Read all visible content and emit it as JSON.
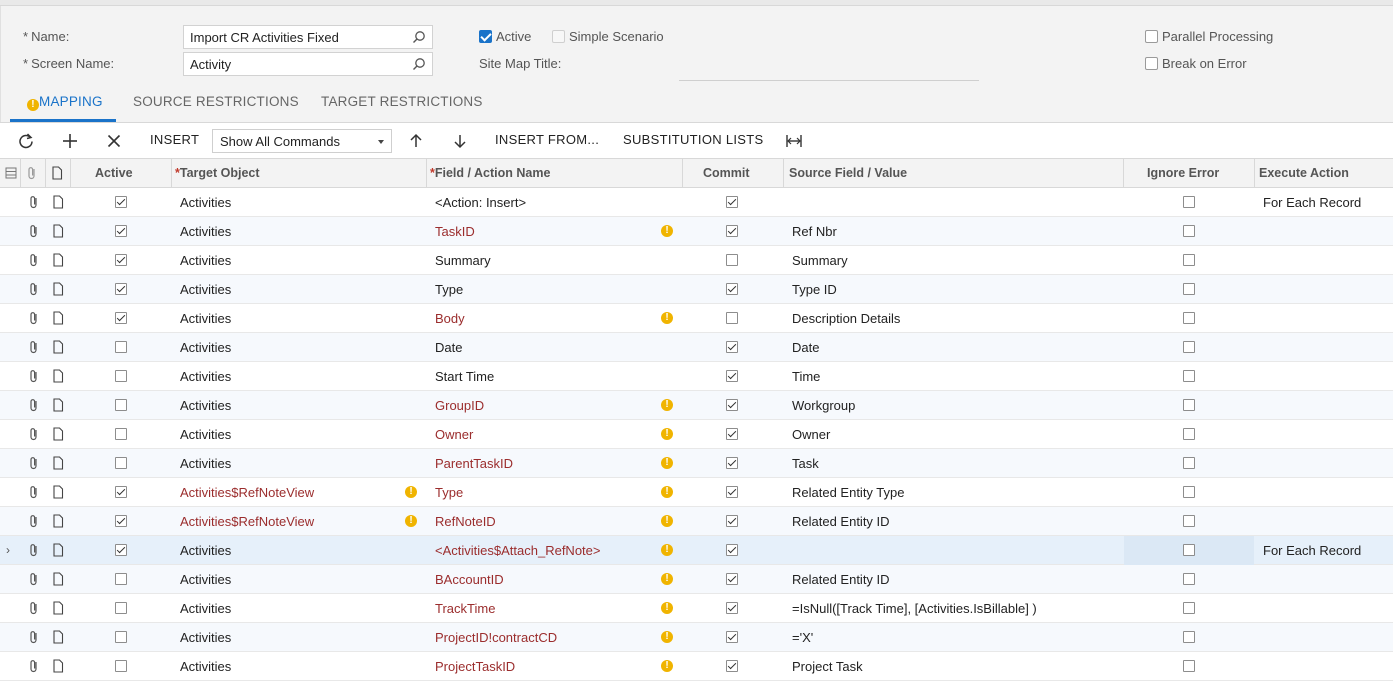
{
  "form": {
    "name_label": "Name:",
    "name_value": "Import CR Activities Fixed",
    "screen_label": "Screen Name:",
    "screen_value": "Activity",
    "active_label": "Active",
    "simple_label": "Simple Scenario",
    "sitemap_label": "Site Map Title:",
    "parallel_label": "Parallel Processing",
    "break_label": "Break on Error",
    "required_mark": "*"
  },
  "tabs": [
    {
      "label": "MAPPING"
    },
    {
      "label": "SOURCE RESTRICTIONS"
    },
    {
      "label": "TARGET RESTRICTIONS"
    }
  ],
  "toolbar": {
    "insert_label": "INSERT",
    "commands_value": "Show All Commands",
    "insert_from_label": "INSERT FROM...",
    "substitution_label": "SUBSTITUTION LISTS"
  },
  "columns": {
    "active": "Active",
    "target": "Target Object",
    "field": "Field / Action Name",
    "commit": "Commit",
    "source": "Source Field / Value",
    "ignore": "Ignore Error",
    "execute": "Execute Action"
  },
  "rows": [
    {
      "active": true,
      "target": "Activities",
      "target_warn": false,
      "field": "<Action: Insert>",
      "field_warn": false,
      "commit": true,
      "source": "",
      "ignore": false,
      "execute": "For Each Record"
    },
    {
      "active": true,
      "target": "Activities",
      "target_warn": false,
      "field": "TaskID",
      "field_warn": true,
      "commit": true,
      "source": "Ref Nbr",
      "ignore": false,
      "execute": ""
    },
    {
      "active": true,
      "target": "Activities",
      "target_warn": false,
      "field": "Summary",
      "field_warn": false,
      "commit": false,
      "source": "Summary",
      "ignore": false,
      "execute": ""
    },
    {
      "active": true,
      "target": "Activities",
      "target_warn": false,
      "field": "Type",
      "field_warn": false,
      "commit": true,
      "source": "Type ID",
      "ignore": false,
      "execute": ""
    },
    {
      "active": true,
      "target": "Activities",
      "target_warn": false,
      "field": "Body",
      "field_warn": true,
      "commit": false,
      "source": "Description Details",
      "ignore": false,
      "execute": ""
    },
    {
      "active": false,
      "target": "Activities",
      "target_warn": false,
      "field": "Date",
      "field_warn": false,
      "commit": true,
      "source": "Date",
      "ignore": false,
      "execute": ""
    },
    {
      "active": false,
      "target": "Activities",
      "target_warn": false,
      "field": "Start Time",
      "field_warn": false,
      "commit": true,
      "source": "Time",
      "ignore": false,
      "execute": ""
    },
    {
      "active": false,
      "target": "Activities",
      "target_warn": false,
      "field": "GroupID",
      "field_warn": true,
      "commit": true,
      "source": "Workgroup",
      "ignore": false,
      "execute": ""
    },
    {
      "active": false,
      "target": "Activities",
      "target_warn": false,
      "field": "Owner",
      "field_warn": true,
      "commit": true,
      "source": "Owner",
      "ignore": false,
      "execute": ""
    },
    {
      "active": false,
      "target": "Activities",
      "target_warn": false,
      "field": "ParentTaskID",
      "field_warn": true,
      "commit": true,
      "source": "Task",
      "ignore": false,
      "execute": ""
    },
    {
      "active": true,
      "target": "Activities$RefNoteView",
      "target_warn": true,
      "field": "Type",
      "field_warn": true,
      "commit": true,
      "source": "Related Entity Type",
      "ignore": false,
      "execute": ""
    },
    {
      "active": true,
      "target": "Activities$RefNoteView",
      "target_warn": true,
      "field": "RefNoteID",
      "field_warn": true,
      "commit": true,
      "source": "Related Entity ID",
      "ignore": false,
      "execute": ""
    },
    {
      "active": true,
      "target": "Activities",
      "target_warn": false,
      "field": "<Activities$Attach_RefNote>",
      "field_warn": true,
      "commit": true,
      "source": "",
      "ignore": false,
      "execute": "For Each Record",
      "selected": true
    },
    {
      "active": false,
      "target": "Activities",
      "target_warn": false,
      "field": "BAccountID",
      "field_warn": true,
      "commit": true,
      "source": "Related Entity ID",
      "ignore": false,
      "execute": ""
    },
    {
      "active": false,
      "target": "Activities",
      "target_warn": false,
      "field": "TrackTime",
      "field_warn": true,
      "commit": true,
      "source": "=IsNull([Track Time], [Activities.IsBillable] )",
      "ignore": false,
      "execute": ""
    },
    {
      "active": false,
      "target": "Activities",
      "target_warn": false,
      "field": "ProjectID!contractCD",
      "field_warn": true,
      "commit": true,
      "source": "='X'",
      "ignore": false,
      "execute": ""
    },
    {
      "active": false,
      "target": "Activities",
      "target_warn": false,
      "field": "ProjectTaskID",
      "field_warn": true,
      "commit": true,
      "source": "Project Task",
      "ignore": false,
      "execute": ""
    }
  ],
  "colors": {
    "accent": "#1a73c9",
    "warning": "#f0b400",
    "error_text": "#9b2d2d"
  },
  "icons": [
    "search-icon",
    "refresh-icon",
    "plus-icon",
    "close-icon",
    "arrow-up-icon",
    "arrow-down-icon",
    "fit-columns-icon",
    "paperclip-icon",
    "note-icon",
    "warning-icon"
  ]
}
